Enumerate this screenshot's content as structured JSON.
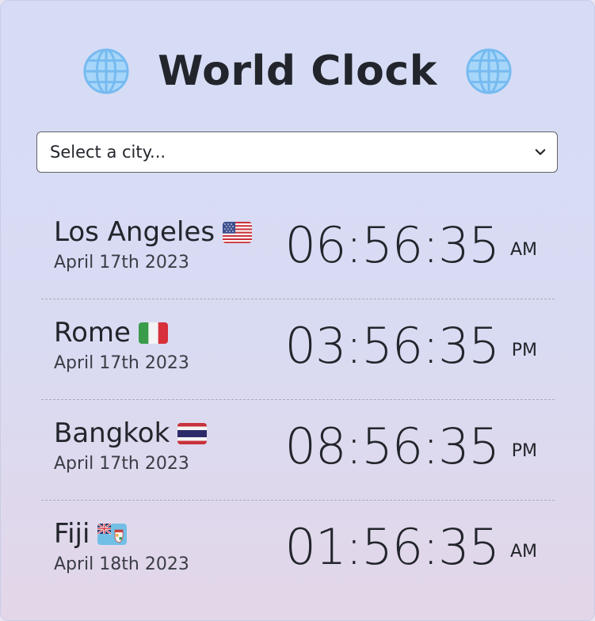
{
  "header": {
    "title": "World Clock",
    "left_icon": "globe-icon",
    "right_icon": "globe-icon"
  },
  "city_select": {
    "placeholder": "Select a city..."
  },
  "clocks": [
    {
      "city": "Los Angeles",
      "flag": "us-flag-icon",
      "date": "April 17th 2023",
      "time": "06:56:35",
      "ampm": "AM"
    },
    {
      "city": "Rome",
      "flag": "italy-flag-icon",
      "date": "April 17th 2023",
      "time": "03:56:35",
      "ampm": "PM"
    },
    {
      "city": "Bangkok",
      "flag": "thailand-flag-icon",
      "date": "April 17th 2023",
      "time": "08:56:35",
      "ampm": "PM"
    },
    {
      "city": "Fiji",
      "flag": "fiji-flag-icon",
      "date": "April 18th 2023",
      "time": "01:56:35",
      "ampm": "AM"
    }
  ],
  "colors": {
    "globe": "#8fc9f5",
    "text": "#22252b"
  }
}
